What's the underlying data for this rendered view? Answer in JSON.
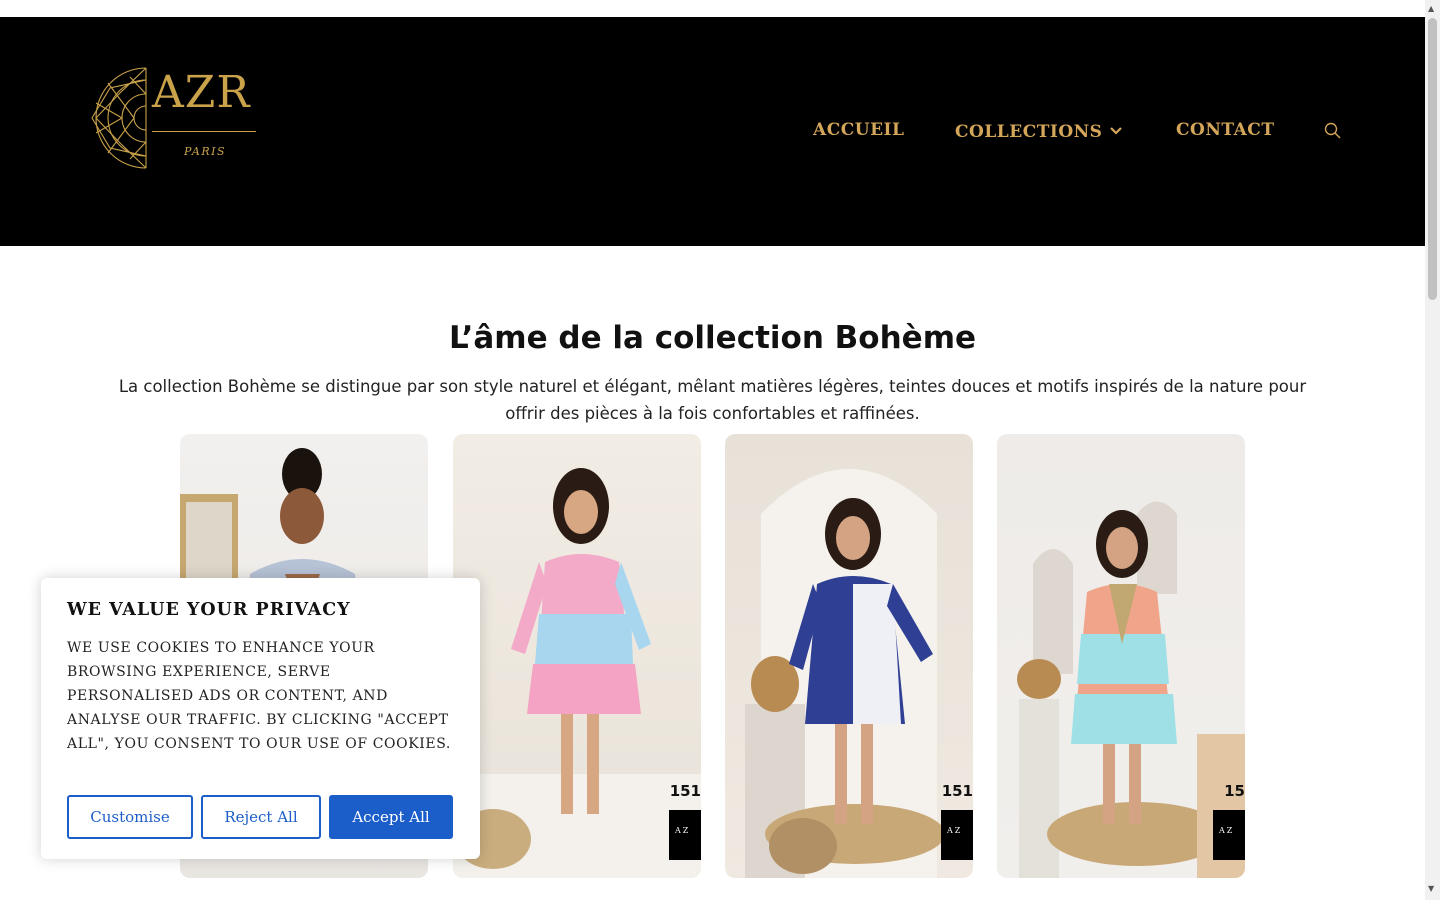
{
  "header": {
    "logo": {
      "title": "AZR",
      "subtitle": "PARIS",
      "icon": "mandala-icon"
    },
    "nav": {
      "accueil": "ACCUEIL",
      "collections": "COLLECTIONS",
      "contact": "CONTACT",
      "search_icon": "search-icon"
    },
    "colors": {
      "background": "#000000",
      "accent": "#d4a65a"
    }
  },
  "main": {
    "headline": "L’âme de la collection Bohème",
    "intro": "La collection Bohème se distingue par son style naturel et élégant, mêlant matières légères, teintes douces et motifs inspirés de la nature pour offrir des pièces à la fois confortables et raffinées.",
    "products": [
      {
        "num": "",
        "tag": ""
      },
      {
        "num": "151",
        "tag": "AZ"
      },
      {
        "num": "151",
        "tag": "AZ"
      },
      {
        "num": "15",
        "tag": "AZ"
      }
    ]
  },
  "cookie": {
    "title": "WE VALUE YOUR PRIVACY",
    "text": "WE USE COOKIES TO ENHANCE YOUR BROWSING EXPERIENCE, SERVE PERSONALISED ADS OR CONTENT, AND ANALYSE OUR TRAFFIC. BY CLICKING \"ACCEPT ALL\", YOU CONSENT TO OUR USE OF COOKIES.",
    "buttons": {
      "customise": "Customise",
      "reject": "Reject All",
      "accept": "Accept All"
    },
    "colors": {
      "primary": "#1c5ec9"
    }
  }
}
